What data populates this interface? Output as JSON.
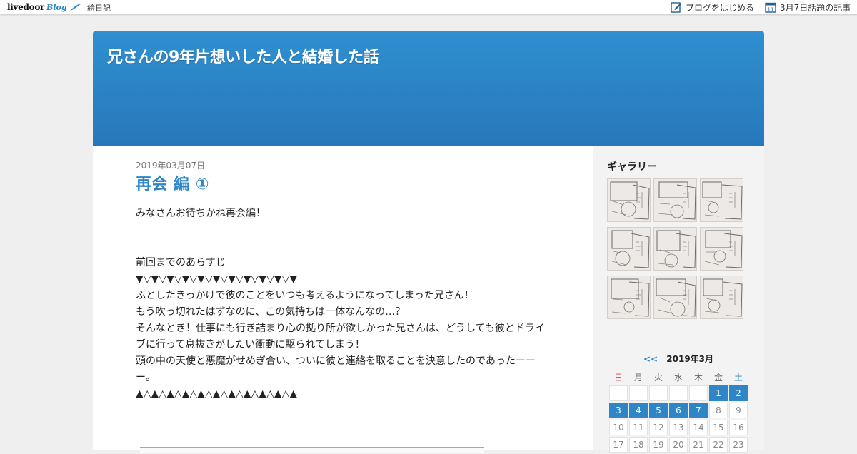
{
  "topbar": {
    "logo_text": "livedoor",
    "logo_blog": "Blog",
    "category_link": "絵日記",
    "start_blog": "ブログをはじめる",
    "today_topic": "3月7日話題の記事",
    "calendar_icon_day": "11"
  },
  "header": {
    "blog_title": "兄さんの9年片想いした人と結婚した話"
  },
  "post": {
    "date": "2019年03月07日",
    "title": "再会 編 ①",
    "intro": "みなさんお待ちかね再会編！",
    "lines": [
      "前回までのあらすじ",
      "▼▽▼▽▼▽▼▽▼▽▼▽▼▽▼▽▼▽▼▽▼",
      "ふとしたきっかけで彼のことをいつも考えるようになってしまった兄さん！",
      "もう吹っ切れたはずなのに、この気持ちは一体なんなの…？",
      "そんなとき！仕事にも行き詰まり心の拠り所が欲しかった兄さんは、どうしても彼とドライブに行って息抜きがしたい衝動に駆られてしまう！",
      "頭の中の天使と悪魔がせめぎ合い、ついに彼と連絡を取ることを決意したのであったーーー。",
      "▲△▲△▲△▲△▲△▲△▲△▲△▲△▲△▲"
    ]
  },
  "sidebar": {
    "gallery_heading": "ギャラリー",
    "gallery_count": 9,
    "calendar": {
      "prev": "<<",
      "month": "2019年3月",
      "weekdays": [
        "日",
        "月",
        "火",
        "水",
        "木",
        "金",
        "土"
      ],
      "rows": [
        [
          "",
          "",
          "",
          "",
          "",
          "1",
          "2"
        ],
        [
          "3",
          "4",
          "5",
          "6",
          "7",
          "8",
          "9"
        ],
        [
          "10",
          "11",
          "12",
          "13",
          "14",
          "15",
          "16"
        ],
        [
          "17",
          "18",
          "19",
          "20",
          "21",
          "22",
          "23"
        ]
      ],
      "linked_days": [
        "1",
        "2",
        "3",
        "4",
        "5",
        "6",
        "7"
      ]
    }
  },
  "colors": {
    "accent": "#2e86c6",
    "header_top": "#2f8fd0",
    "header_bottom": "#2778bb",
    "sunday": "#d9443b"
  }
}
